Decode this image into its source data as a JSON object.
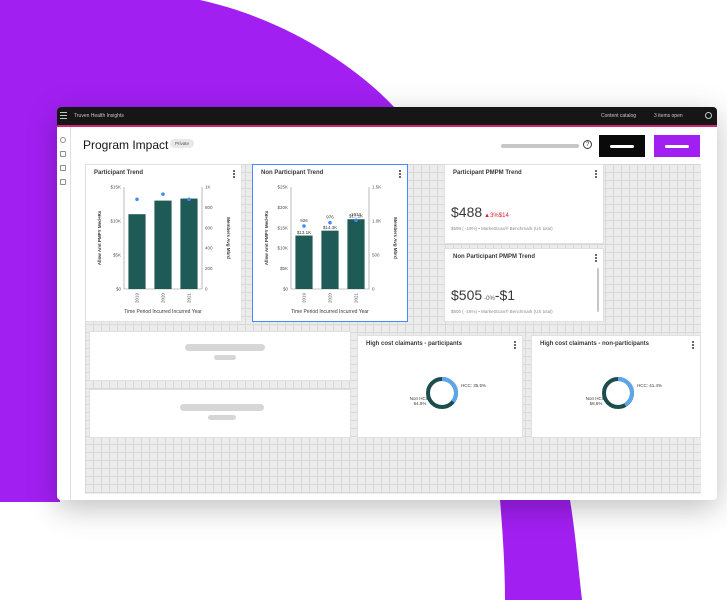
{
  "topbar": {
    "app_title": "Truven Health Insights",
    "content_catalog": "Content catalog",
    "items_open": "3 items open"
  },
  "header": {
    "page_title": "Program Impact",
    "badge": "Private"
  },
  "cards": {
    "participant_trend": {
      "title": "Participant Trend"
    },
    "non_participant_trend": {
      "title": "Non Participant Trend"
    },
    "participant_pmpm": {
      "title": "Participant PMPM Trend",
      "value": "$488",
      "delta": "▲3%$14",
      "sub": "$598 ( -19%) • MarketScan® Benchmark (US total)"
    },
    "non_participant_pmpm": {
      "title": "Non Participant PMPM Trend",
      "value": "$505",
      "delta": "-0%",
      "delta_value": "-$1",
      "sub": "$600 ( -16%) • MarketScan® Benchmark (US total)"
    },
    "hcc_participants": {
      "title": "High cost claimants - participants"
    },
    "hcc_non_participants": {
      "title": "High cost claimants - non-participants"
    }
  },
  "chart_data": [
    {
      "type": "bar",
      "title": "Participant Trend",
      "xlabel": "Time Period Incurred Incurred Year",
      "ylabel": "Allow Amt PMPY Med+Rx",
      "y2label": "Members Avg Mbrd",
      "categories": [
        "2019",
        "2020",
        "2021"
      ],
      "ylim": [
        0,
        15000
      ],
      "yticks": [
        "$0",
        "$5K",
        "$10K",
        "$15K"
      ],
      "y2lim": [
        0,
        1000
      ],
      "y2ticks": [
        "0",
        "200",
        "400",
        "600",
        "800",
        "1K"
      ],
      "series": [
        {
          "name": "Allow Amt PMPY Med+Rx",
          "values": [
            11000,
            13000,
            13300
          ]
        },
        {
          "name": "Members Avg Mbrd",
          "values": [
            880,
            930,
            880
          ]
        }
      ]
    },
    {
      "type": "bar",
      "title": "Non Participant Trend",
      "xlabel": "Time Period Incurred Incurred Year",
      "ylabel": "Allow Amt PMPY Med+Rx",
      "y2label": "Members Avg Mbrd",
      "categories": [
        "2019",
        "2020",
        "2021"
      ],
      "ylim": [
        0,
        25000
      ],
      "yticks": [
        "$0",
        "$5K",
        "$10K",
        "$15K",
        "$20K",
        "$25K"
      ],
      "y2lim": [
        0,
        1500
      ],
      "y2ticks": [
        "0",
        "500",
        "1.0K",
        "1.5K"
      ],
      "series": [
        {
          "name": "Allow Amt PMPY Med+Rx",
          "values": [
            13100,
            14300,
            17100
          ]
        },
        {
          "name": "Members Avg Mbrd",
          "values": [
            926,
            976,
            1013
          ]
        }
      ],
      "bar_labels": [
        "$13.1K",
        "$14.3K",
        "$17.1K"
      ],
      "point_labels": [
        "926",
        "976",
        "1013"
      ]
    },
    {
      "type": "pie",
      "title": "High cost claimants - participants",
      "slices": [
        {
          "label": "HCC",
          "value": 35.5,
          "text": "HCC: 35.5%"
        },
        {
          "label": "Non HCC",
          "value": 64.5,
          "text": "Non HCC: 64.5%"
        }
      ]
    },
    {
      "type": "pie",
      "title": "High cost claimants - non-participants",
      "slices": [
        {
          "label": "HCC",
          "value": 41.4,
          "text": "HCC: 41.4%"
        },
        {
          "label": "Non HCC",
          "value": 58.6,
          "text": "Non HCC: 58.6%"
        }
      ]
    }
  ],
  "colors": {
    "purple": "#a21ff2",
    "bar": "#1e5a56",
    "point": "#4589ff",
    "donut_dark": "#1e4d50",
    "donut_light": "#5aa6e8",
    "alert": "#da1e28"
  }
}
